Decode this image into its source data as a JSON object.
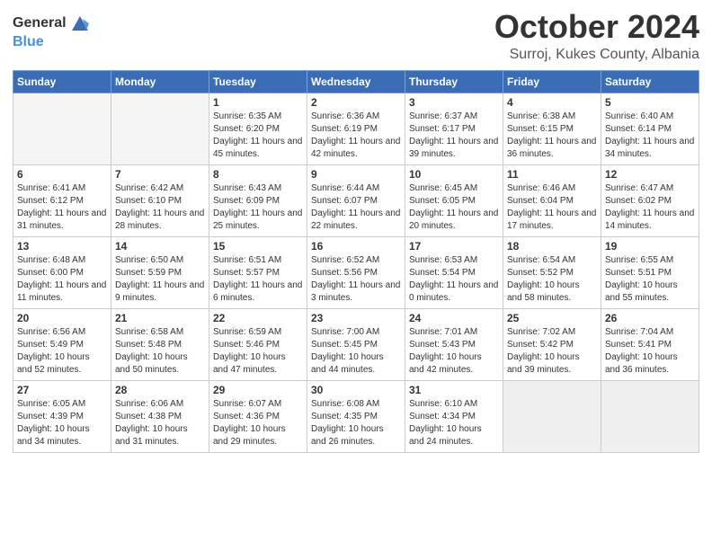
{
  "header": {
    "logo_general": "General",
    "logo_blue": "Blue",
    "month_title": "October 2024",
    "location": "Surroj, Kukes County, Albania"
  },
  "weekdays": [
    "Sunday",
    "Monday",
    "Tuesday",
    "Wednesday",
    "Thursday",
    "Friday",
    "Saturday"
  ],
  "weeks": [
    [
      {
        "day": "",
        "empty": true
      },
      {
        "day": "",
        "empty": true
      },
      {
        "day": "1",
        "sunrise": "6:35 AM",
        "sunset": "6:20 PM",
        "daylight": "11 hours and 45 minutes."
      },
      {
        "day": "2",
        "sunrise": "6:36 AM",
        "sunset": "6:19 PM",
        "daylight": "11 hours and 42 minutes."
      },
      {
        "day": "3",
        "sunrise": "6:37 AM",
        "sunset": "6:17 PM",
        "daylight": "11 hours and 39 minutes."
      },
      {
        "day": "4",
        "sunrise": "6:38 AM",
        "sunset": "6:15 PM",
        "daylight": "11 hours and 36 minutes."
      },
      {
        "day": "5",
        "sunrise": "6:40 AM",
        "sunset": "6:14 PM",
        "daylight": "11 hours and 34 minutes."
      }
    ],
    [
      {
        "day": "6",
        "sunrise": "6:41 AM",
        "sunset": "6:12 PM",
        "daylight": "11 hours and 31 minutes."
      },
      {
        "day": "7",
        "sunrise": "6:42 AM",
        "sunset": "6:10 PM",
        "daylight": "11 hours and 28 minutes."
      },
      {
        "day": "8",
        "sunrise": "6:43 AM",
        "sunset": "6:09 PM",
        "daylight": "11 hours and 25 minutes."
      },
      {
        "day": "9",
        "sunrise": "6:44 AM",
        "sunset": "6:07 PM",
        "daylight": "11 hours and 22 minutes."
      },
      {
        "day": "10",
        "sunrise": "6:45 AM",
        "sunset": "6:05 PM",
        "daylight": "11 hours and 20 minutes."
      },
      {
        "day": "11",
        "sunrise": "6:46 AM",
        "sunset": "6:04 PM",
        "daylight": "11 hours and 17 minutes."
      },
      {
        "day": "12",
        "sunrise": "6:47 AM",
        "sunset": "6:02 PM",
        "daylight": "11 hours and 14 minutes."
      }
    ],
    [
      {
        "day": "13",
        "sunrise": "6:48 AM",
        "sunset": "6:00 PM",
        "daylight": "11 hours and 11 minutes."
      },
      {
        "day": "14",
        "sunrise": "6:50 AM",
        "sunset": "5:59 PM",
        "daylight": "11 hours and 9 minutes."
      },
      {
        "day": "15",
        "sunrise": "6:51 AM",
        "sunset": "5:57 PM",
        "daylight": "11 hours and 6 minutes."
      },
      {
        "day": "16",
        "sunrise": "6:52 AM",
        "sunset": "5:56 PM",
        "daylight": "11 hours and 3 minutes."
      },
      {
        "day": "17",
        "sunrise": "6:53 AM",
        "sunset": "5:54 PM",
        "daylight": "11 hours and 0 minutes."
      },
      {
        "day": "18",
        "sunrise": "6:54 AM",
        "sunset": "5:52 PM",
        "daylight": "10 hours and 58 minutes."
      },
      {
        "day": "19",
        "sunrise": "6:55 AM",
        "sunset": "5:51 PM",
        "daylight": "10 hours and 55 minutes."
      }
    ],
    [
      {
        "day": "20",
        "sunrise": "6:56 AM",
        "sunset": "5:49 PM",
        "daylight": "10 hours and 52 minutes."
      },
      {
        "day": "21",
        "sunrise": "6:58 AM",
        "sunset": "5:48 PM",
        "daylight": "10 hours and 50 minutes."
      },
      {
        "day": "22",
        "sunrise": "6:59 AM",
        "sunset": "5:46 PM",
        "daylight": "10 hours and 47 minutes."
      },
      {
        "day": "23",
        "sunrise": "7:00 AM",
        "sunset": "5:45 PM",
        "daylight": "10 hours and 44 minutes."
      },
      {
        "day": "24",
        "sunrise": "7:01 AM",
        "sunset": "5:43 PM",
        "daylight": "10 hours and 42 minutes."
      },
      {
        "day": "25",
        "sunrise": "7:02 AM",
        "sunset": "5:42 PM",
        "daylight": "10 hours and 39 minutes."
      },
      {
        "day": "26",
        "sunrise": "7:04 AM",
        "sunset": "5:41 PM",
        "daylight": "10 hours and 36 minutes."
      }
    ],
    [
      {
        "day": "27",
        "sunrise": "6:05 AM",
        "sunset": "4:39 PM",
        "daylight": "10 hours and 34 minutes."
      },
      {
        "day": "28",
        "sunrise": "6:06 AM",
        "sunset": "4:38 PM",
        "daylight": "10 hours and 31 minutes."
      },
      {
        "day": "29",
        "sunrise": "6:07 AM",
        "sunset": "4:36 PM",
        "daylight": "10 hours and 29 minutes."
      },
      {
        "day": "30",
        "sunrise": "6:08 AM",
        "sunset": "4:35 PM",
        "daylight": "10 hours and 26 minutes."
      },
      {
        "day": "31",
        "sunrise": "6:10 AM",
        "sunset": "4:34 PM",
        "daylight": "10 hours and 24 minutes."
      },
      {
        "day": "",
        "empty": true
      },
      {
        "day": "",
        "empty": true
      }
    ]
  ]
}
